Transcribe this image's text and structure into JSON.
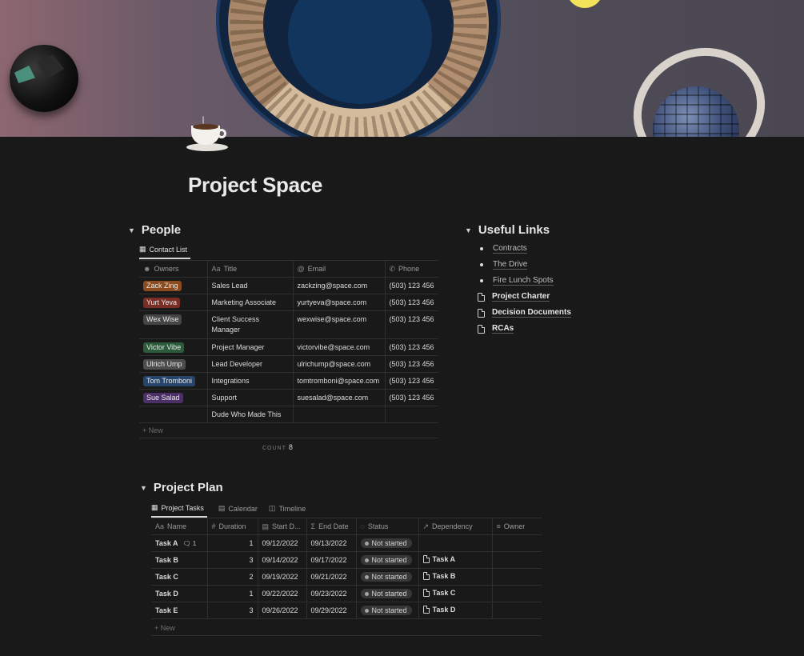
{
  "page": {
    "title": "Project Space",
    "icon": "coffee-cup-icon"
  },
  "people": {
    "heading": "People",
    "tabs": [
      {
        "label": "Contact List",
        "icon": "table-icon"
      }
    ],
    "columns": [
      "Owners",
      "Title",
      "Email",
      "Phone"
    ],
    "rows": [
      {
        "owner": "Zack Zing",
        "owner_color": "#8a4b1e",
        "title": "Sales Lead",
        "email": "zackzing@space.com",
        "phone": "(503) 123 456"
      },
      {
        "owner": "Yurt Yeva",
        "owner_color": "#7a2d25",
        "title": "Marketing Associate",
        "email": "yurtyeva@space.com",
        "phone": "(503) 123 456"
      },
      {
        "owner": "Wex Wise",
        "owner_color": "#454545",
        "title": "Client Success Manager",
        "email": "wexwise@space.com",
        "phone": "(503) 123 456"
      },
      {
        "owner": "Victor Vibe",
        "owner_color": "#2b5b3a",
        "title": "Project Manager",
        "email": "victorvibe@space.com",
        "phone": "(503) 123 456"
      },
      {
        "owner": "Ulrich Ump",
        "owner_color": "#4d4d4d",
        "title": "Lead Developer",
        "email": "ulrichump@space.com",
        "phone": "(503) 123 456"
      },
      {
        "owner": "Tom Tromboni",
        "owner_color": "#27446b",
        "title": "Integrations",
        "email": "tomtromboni@space.com",
        "phone": "(503) 123 456"
      },
      {
        "owner": "Sue Salad",
        "owner_color": "#4c2f66",
        "title": "Support",
        "email": "suesalad@space.com",
        "phone": "(503) 123 456"
      },
      {
        "owner": "",
        "owner_color": "",
        "title": "Dude Who Made This",
        "email": "",
        "phone": ""
      }
    ],
    "new_label": "+ New",
    "count_label": "COUNT",
    "count_value": "8"
  },
  "links": {
    "heading": "Useful Links",
    "bullets": [
      "Contracts",
      "The Drive",
      "Fire Lunch Spots"
    ],
    "pages": [
      "Project Charter",
      "Decision Documents",
      "RCAs"
    ]
  },
  "plan": {
    "heading": "Project Plan",
    "tabs": [
      {
        "label": "Project Tasks",
        "icon": "table-icon",
        "active": true
      },
      {
        "label": "Calendar",
        "icon": "calendar-icon",
        "active": false
      },
      {
        "label": "Timeline",
        "icon": "timeline-icon",
        "active": false
      }
    ],
    "columns": [
      "Name",
      "Duration",
      "Start D...",
      "End Date",
      "Status",
      "Dependency",
      "Owner"
    ],
    "rows": [
      {
        "name": "Task A",
        "comments": "1",
        "duration": "1",
        "start": "09/12/2022",
        "end": "09/13/2022",
        "status": "Not started",
        "dependency": ""
      },
      {
        "name": "Task B",
        "comments": "",
        "duration": "3",
        "start": "09/14/2022",
        "end": "09/17/2022",
        "status": "Not started",
        "dependency": "Task A"
      },
      {
        "name": "Task C",
        "comments": "",
        "duration": "2",
        "start": "09/19/2022",
        "end": "09/21/2022",
        "status": "Not started",
        "dependency": "Task B"
      },
      {
        "name": "Task D",
        "comments": "",
        "duration": "1",
        "start": "09/22/2022",
        "end": "09/23/2022",
        "status": "Not started",
        "dependency": "Task C"
      },
      {
        "name": "Task E",
        "comments": "",
        "duration": "3",
        "start": "09/26/2022",
        "end": "09/29/2022",
        "status": "Not started",
        "dependency": "Task D"
      }
    ],
    "new_label": "+ New"
  }
}
